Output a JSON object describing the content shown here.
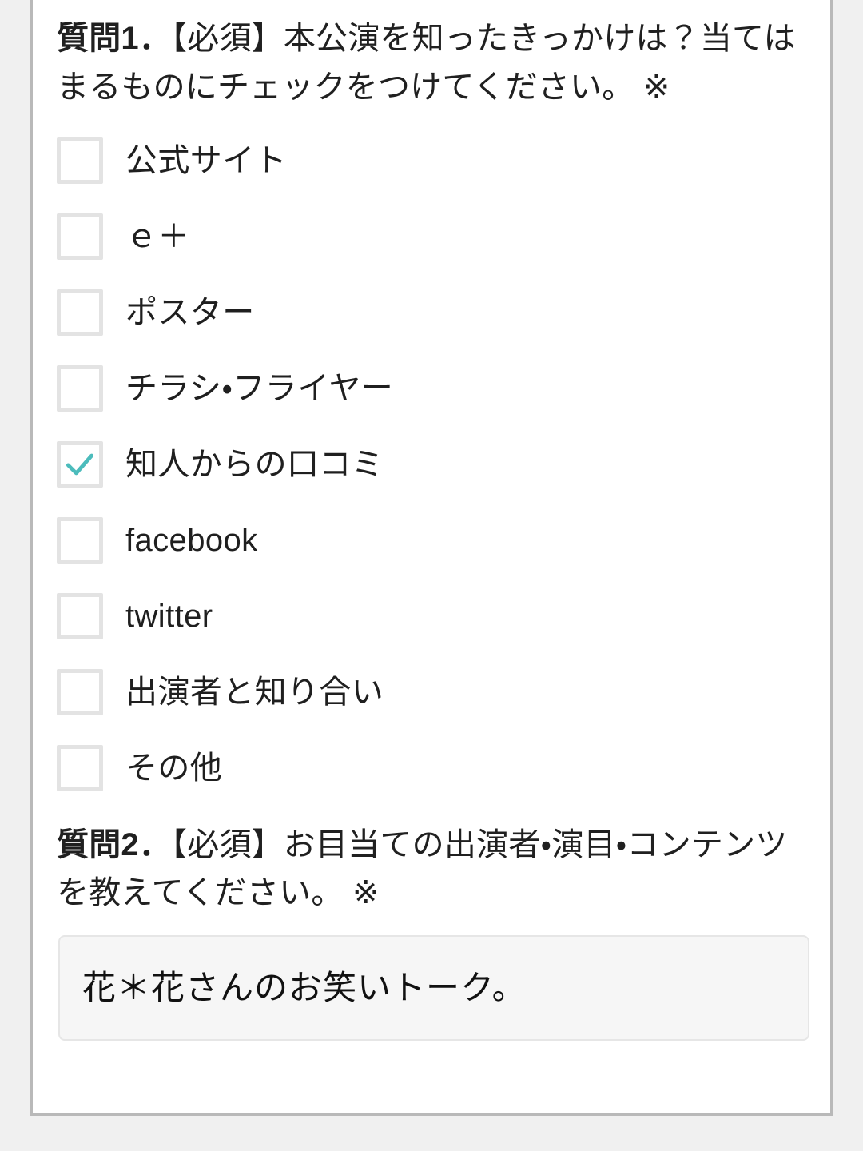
{
  "form": {
    "questions": [
      {
        "id": "q1",
        "label": "質問1．",
        "text": "【必須】本公演を知ったきっかけは？当てはまるものにチェックをつけてください。 ※",
        "type": "checkbox-group",
        "options": [
          {
            "label": "公式サイト",
            "checked": false
          },
          {
            "label": "ｅ＋",
            "checked": false
          },
          {
            "label": "ポスター",
            "checked": false
          },
          {
            "label": "チラシ・フライヤー",
            "checked": false
          },
          {
            "label": "知人からの口コミ",
            "checked": true
          },
          {
            "label": "facebook",
            "checked": false
          },
          {
            "label": "twitter",
            "checked": false
          },
          {
            "label": "出演者と知り合い",
            "checked": false
          },
          {
            "label": "その他",
            "checked": false
          }
        ]
      },
      {
        "id": "q2",
        "label": "質問2．",
        "text": "【必須】お目当ての出演者・演目・コンテンツを教えてください。 ※",
        "type": "text",
        "value": "花＊花さんのお笑いトーク。",
        "placeholder": ""
      }
    ]
  },
  "colors": {
    "page_background": "#f0f0f0",
    "card_background": "#ffffff",
    "card_border": "#b9b9b9",
    "checkbox_border": "#e3e3e3",
    "check_accent": "#4cbcbc",
    "text": "#1f1f1f",
    "input_background": "#f6f6f6",
    "input_border": "#e6e6e6"
  },
  "icons": {
    "check": "check-icon"
  }
}
